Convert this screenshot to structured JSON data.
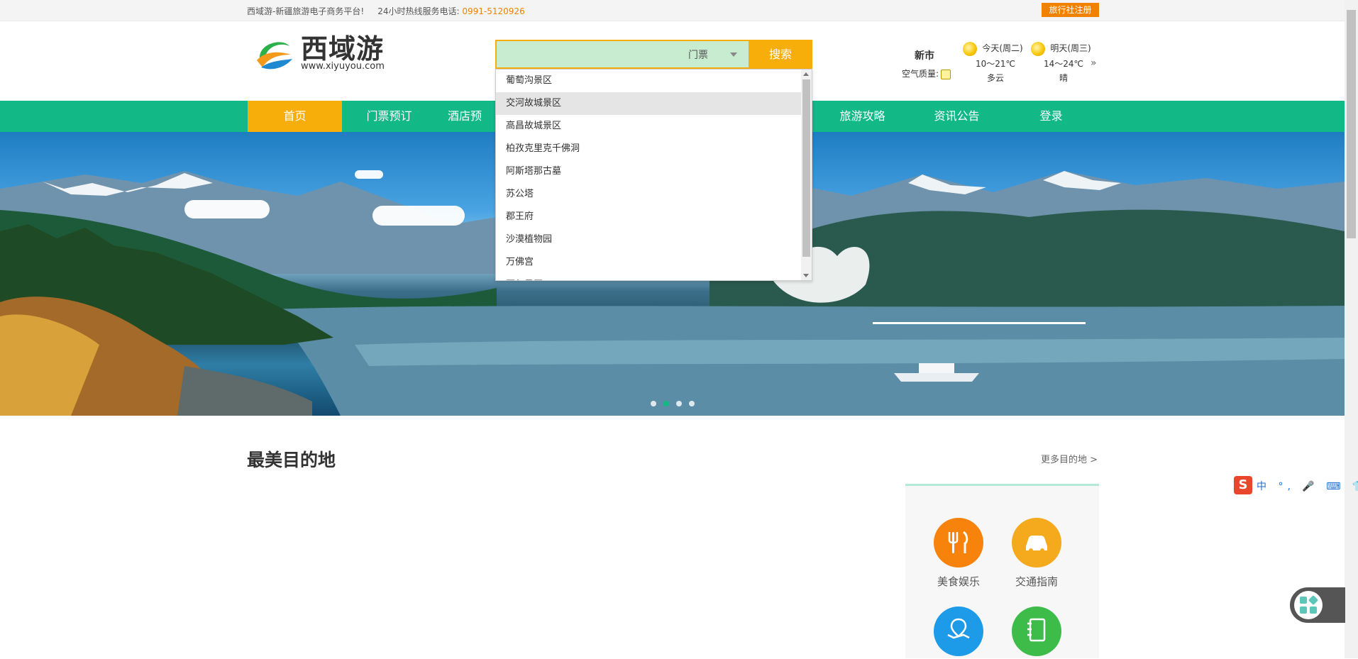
{
  "topbar": {
    "slogan": "西域游-新疆旅游电子商务平台!",
    "hotline_label": "24小时热线服务电话:",
    "hotline_number": "0991-5120926",
    "agency_register": "旅行社注册"
  },
  "header": {
    "logo_name": "西域游",
    "logo_url": "www.xiyuyou.com",
    "search": {
      "value": "",
      "type_selected": "门票",
      "button": "搜索"
    },
    "weather": {
      "city": "新市",
      "air_quality_label": "空气质量:",
      "today_label": "今天(周二)",
      "today_temp": "10～21℃",
      "today_cond": "多云",
      "tomorrow_label": "明天(周三)",
      "tomorrow_temp": "14～24℃",
      "tomorrow_cond": "晴",
      "more": "»"
    }
  },
  "nav": {
    "items": [
      "首页",
      "门票预订",
      "酒店预",
      "旅游攻略",
      "资讯公告",
      "登录"
    ]
  },
  "dropdown": {
    "items": [
      "葡萄沟景区",
      "交河故城景区",
      "高昌故城景区",
      "柏孜克里克千佛洞",
      "阿斯塔那古墓",
      "苏公塔",
      "郡王府",
      "沙漠植物园",
      "万佛宫",
      "亚尔景区"
    ]
  },
  "banner": {
    "active_slide": 2,
    "slide_count": 4
  },
  "section": {
    "title": "最美目的地",
    "more": "更多目的地 >",
    "services": [
      "美食娱乐",
      "交通指南"
    ]
  },
  "ime": {
    "logo": "S",
    "tools": "中 °, 🎤 ⌨ 👕 ▦"
  },
  "colors": {
    "nav_green": "#12b886",
    "accent_orange": "#f7ae0a",
    "phone_orange": "#f08200",
    "food_circle": "#f7820c",
    "traffic_circle": "#f5a91d",
    "map_circle": "#1e9be8",
    "guide_circle": "#3dbc4a"
  }
}
